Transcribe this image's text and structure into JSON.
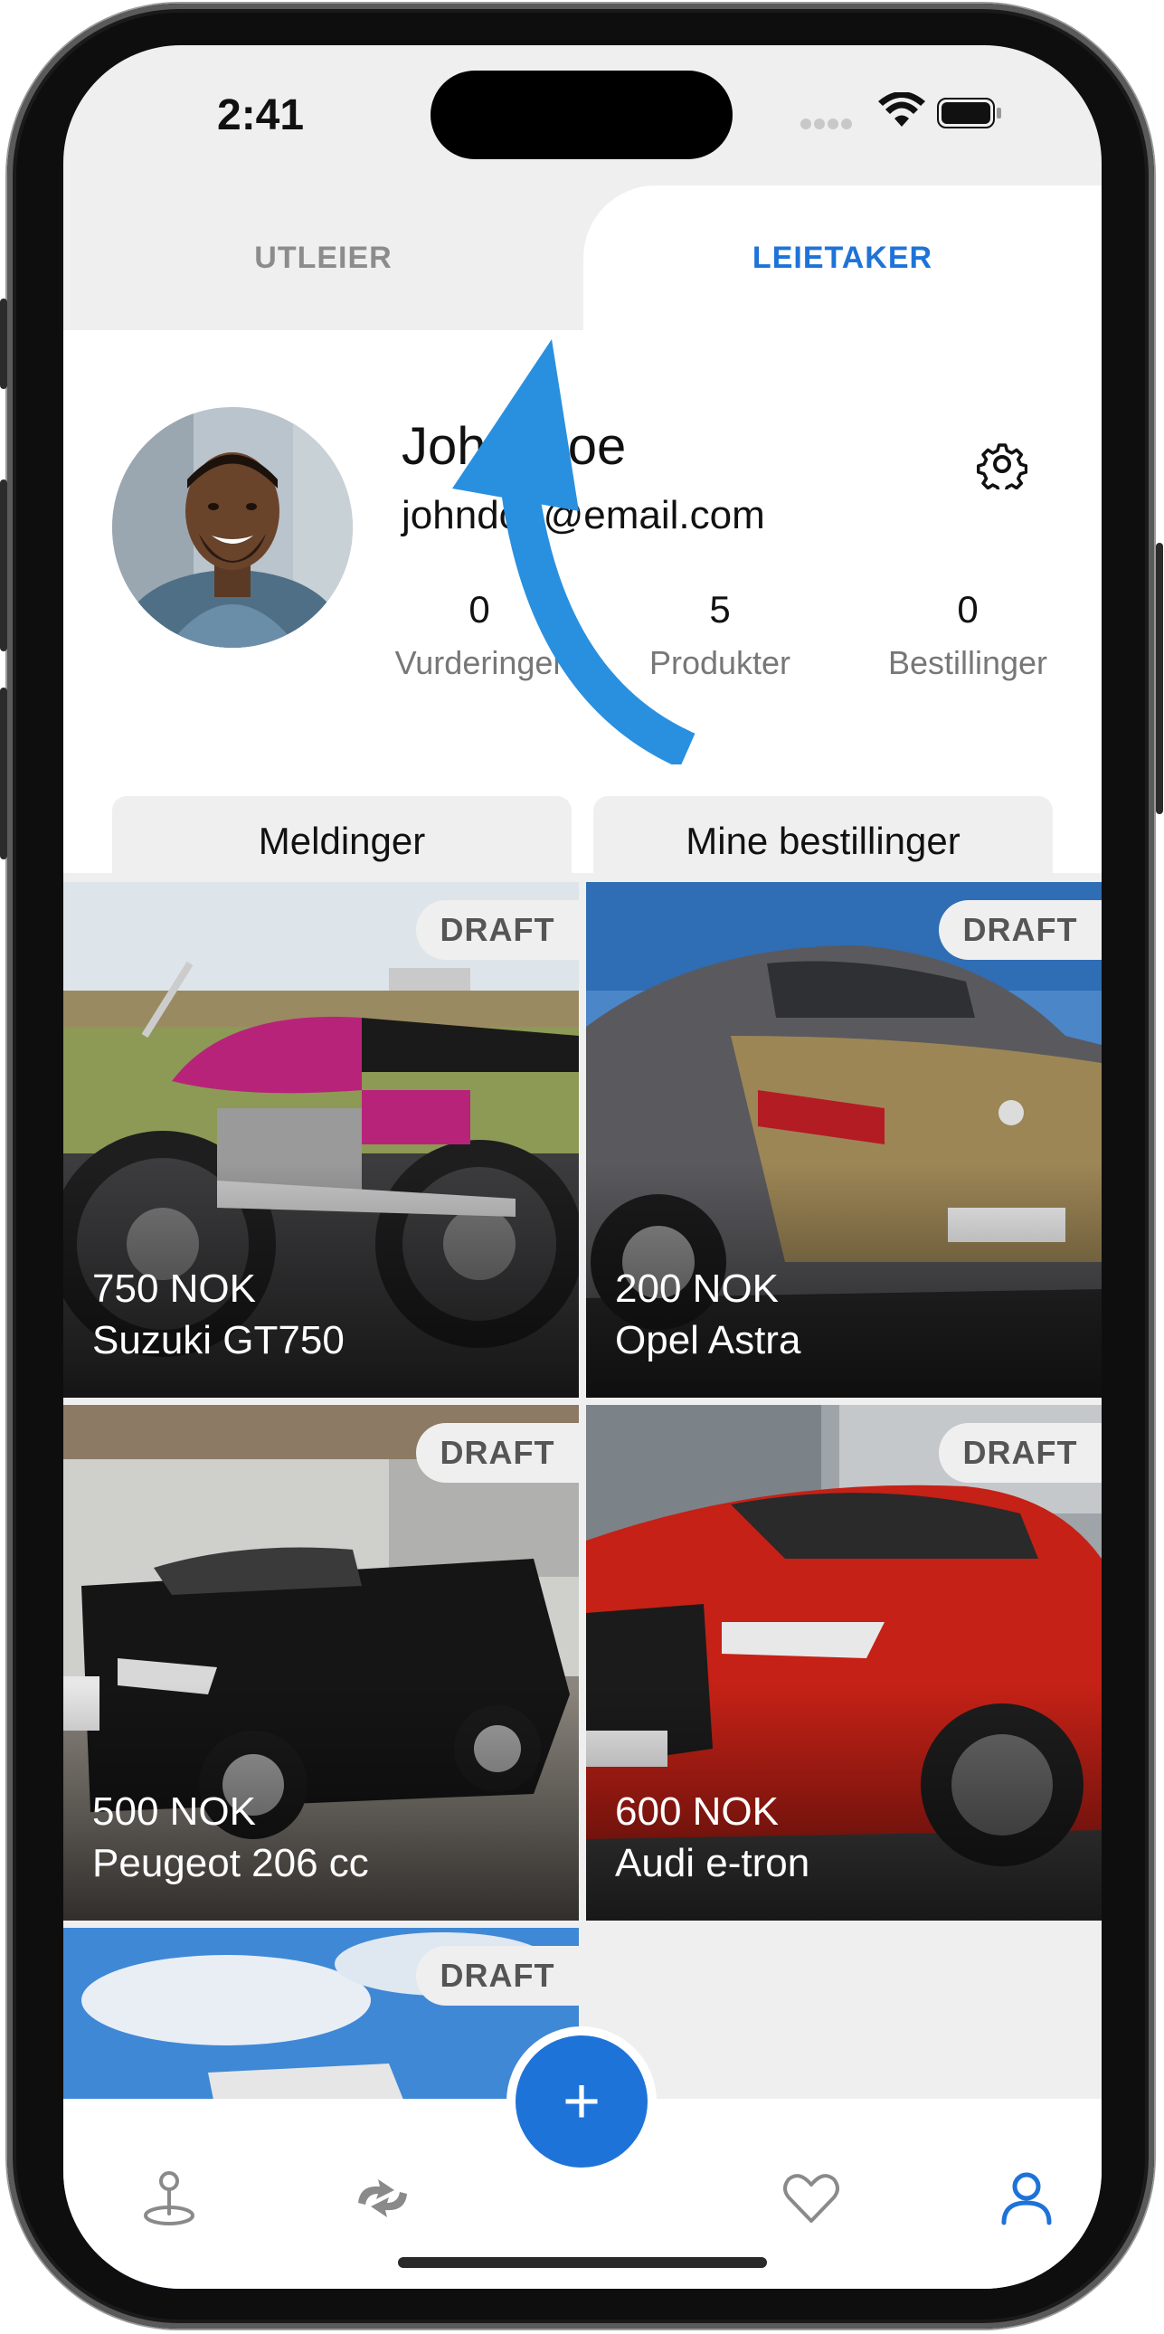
{
  "status_bar": {
    "time": "2:41"
  },
  "tabs": {
    "left": "UTLEIER",
    "right": "LEIETAKER",
    "active": "right"
  },
  "profile": {
    "name": "John Doe",
    "email": "johndoe@email.com",
    "stats": [
      {
        "value": "0",
        "label": "Vurderinger"
      },
      {
        "value": "5",
        "label": "Produkter"
      },
      {
        "value": "0",
        "label": "Bestillinger"
      }
    ],
    "buttons": {
      "messages": "Meldinger",
      "my_orders": "Mine bestillinger"
    }
  },
  "listings": [
    {
      "badge": "DRAFT",
      "price": "750 NOK",
      "title": "Suzuki GT750"
    },
    {
      "badge": "DRAFT",
      "price": "200 NOK",
      "title": "Opel Astra"
    },
    {
      "badge": "DRAFT",
      "price": "500 NOK",
      "title": "Peugeot 206 cc"
    },
    {
      "badge": "DRAFT",
      "price": "600 NOK",
      "title": "Audi e-tron"
    },
    {
      "badge": "DRAFT",
      "price": "",
      "title": ""
    }
  ],
  "fab": {
    "label": "+"
  },
  "nav": {
    "icons": [
      "map-pin-icon",
      "exchange-icon",
      "heart-icon",
      "user-icon"
    ],
    "active": "user-icon"
  },
  "colors": {
    "accent": "#1e73d8",
    "badge_bg": "#efefef",
    "arrow": "#2990e0"
  }
}
